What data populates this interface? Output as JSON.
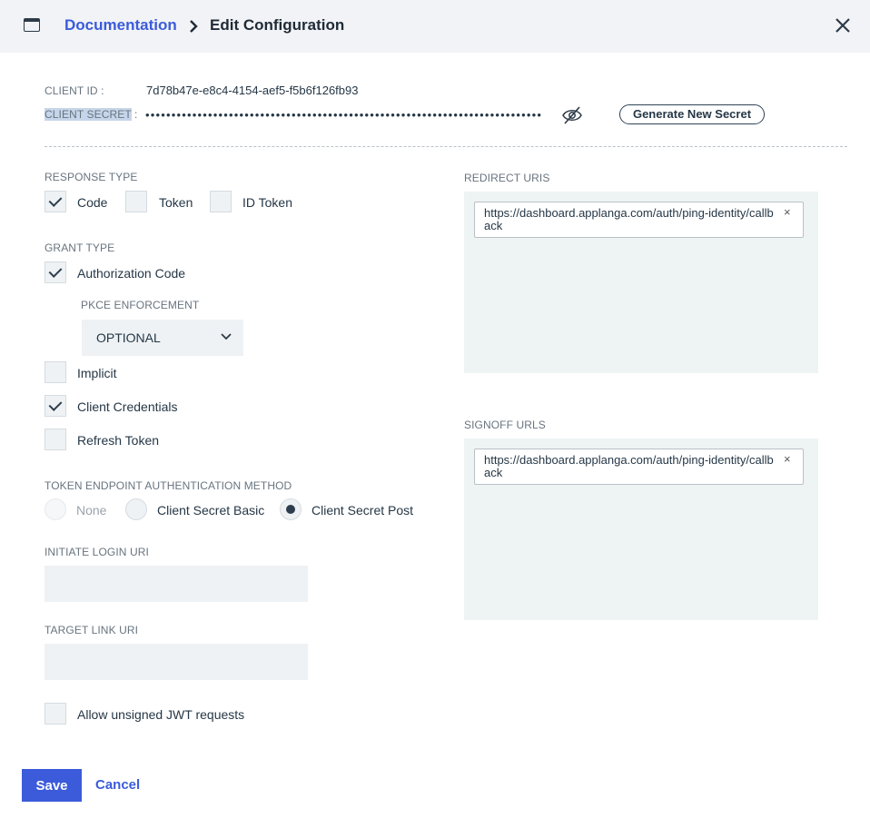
{
  "header": {
    "window_icon": "window-icon",
    "breadcrumb_link": "Documentation",
    "separator_icon": "chevron-right-icon",
    "title": "Edit Configuration",
    "close_icon": "close-icon"
  },
  "credentials": {
    "client_id_label": "CLIENT ID :",
    "client_id_value": "7d78b47e-e8c4-4154-aef5-f5b6f126fb93",
    "client_secret_label": "CLIENT SECRET",
    "client_secret_colon": " :",
    "client_secret_masked": "••••••••••••••••••••••••••••••••••••••••••••••••••••••••••••••••••••••••••••",
    "toggle_visibility_icon": "eye-slash-icon",
    "generate_button": "Generate New Secret"
  },
  "response_type": {
    "label": "RESPONSE TYPE",
    "options": [
      {
        "label": "Code",
        "checked": true
      },
      {
        "label": "Token",
        "checked": false
      },
      {
        "label": "ID Token",
        "checked": false
      }
    ]
  },
  "grant_type": {
    "label": "GRANT TYPE",
    "authorization_code": {
      "label": "Authorization Code",
      "checked": true
    },
    "pkce_label": "PKCE ENFORCEMENT",
    "pkce_value": "OPTIONAL",
    "implicit": {
      "label": "Implicit",
      "checked": false
    },
    "client_credentials": {
      "label": "Client Credentials",
      "checked": true
    },
    "refresh_token": {
      "label": "Refresh Token",
      "checked": false
    }
  },
  "token_auth": {
    "label": "TOKEN ENDPOINT AUTHENTICATION METHOD",
    "options": [
      {
        "label": "None",
        "selected": false,
        "disabled": true
      },
      {
        "label": "Client Secret Basic",
        "selected": false,
        "disabled": false
      },
      {
        "label": "Client Secret Post",
        "selected": true,
        "disabled": false
      }
    ]
  },
  "initiate_login": {
    "label": "INITIATE LOGIN URI",
    "value": ""
  },
  "target_link": {
    "label": "TARGET LINK URI",
    "value": ""
  },
  "allow_unsigned": {
    "label": "Allow unsigned JWT requests",
    "checked": false
  },
  "redirect_uris": {
    "label": "REDIRECT URIS",
    "items": [
      "https://dashboard.applanga.com/auth/ping-identity/callback"
    ],
    "remove_glyph": "×"
  },
  "signoff_urls": {
    "label": "SIGNOFF URLS",
    "items": [
      "https://dashboard.applanga.com/auth/ping-identity/callback"
    ],
    "remove_glyph": "×"
  },
  "actions": {
    "save": "Save",
    "cancel": "Cancel"
  },
  "colors": {
    "accent": "#3b5bdb",
    "panel_bg": "#eef4f4",
    "header_bg": "#f1f3f6"
  }
}
